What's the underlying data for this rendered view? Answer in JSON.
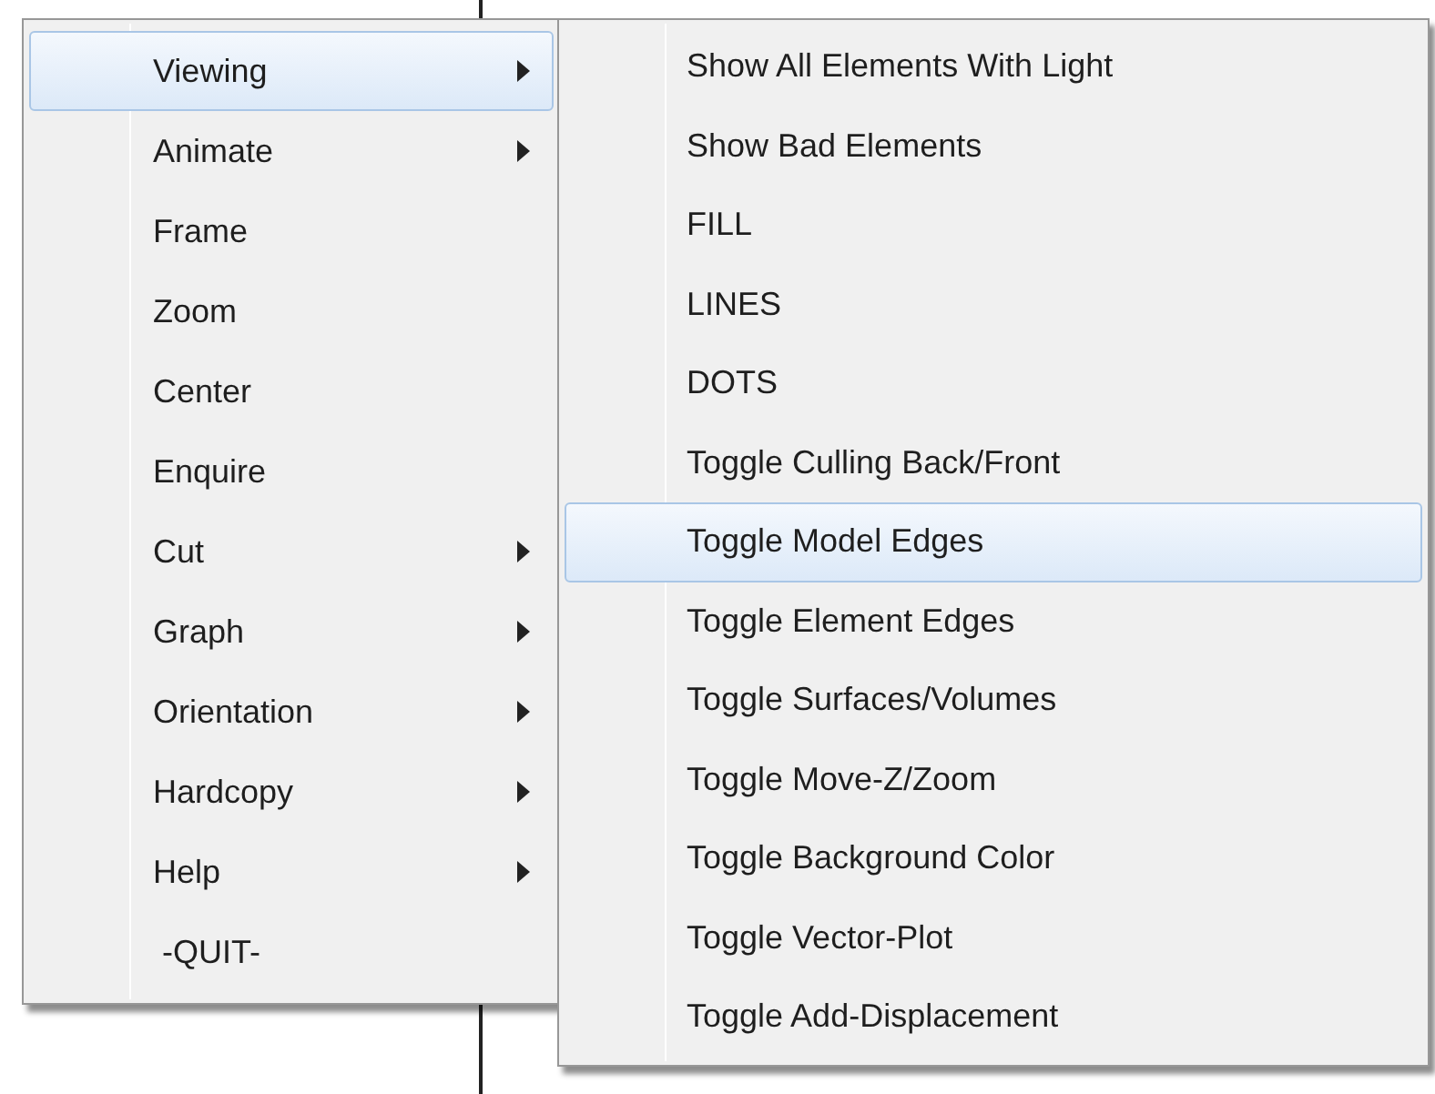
{
  "menu": {
    "items": [
      {
        "label": "Viewing",
        "has_submenu": true,
        "selected": true
      },
      {
        "label": "Animate",
        "has_submenu": true,
        "selected": false
      },
      {
        "label": "Frame",
        "has_submenu": false,
        "selected": false
      },
      {
        "label": "Zoom",
        "has_submenu": false,
        "selected": false
      },
      {
        "label": "Center",
        "has_submenu": false,
        "selected": false
      },
      {
        "label": "Enquire",
        "has_submenu": false,
        "selected": false
      },
      {
        "label": "Cut",
        "has_submenu": true,
        "selected": false
      },
      {
        "label": "Graph",
        "has_submenu": true,
        "selected": false
      },
      {
        "label": "Orientation",
        "has_submenu": true,
        "selected": false
      },
      {
        "label": "Hardcopy",
        "has_submenu": true,
        "selected": false
      },
      {
        "label": "Help",
        "has_submenu": true,
        "selected": false
      },
      {
        "label": " -QUIT-",
        "has_submenu": false,
        "selected": false
      }
    ]
  },
  "submenu": {
    "items": [
      {
        "label": "Show All Elements With Light",
        "selected": false
      },
      {
        "label": "Show Bad Elements",
        "selected": false
      },
      {
        "label": "FILL",
        "selected": false
      },
      {
        "label": "LINES",
        "selected": false
      },
      {
        "label": "DOTS",
        "selected": false
      },
      {
        "label": "Toggle Culling Back/Front",
        "selected": false
      },
      {
        "label": "Toggle Model Edges",
        "selected": true
      },
      {
        "label": "Toggle Element Edges",
        "selected": false
      },
      {
        "label": "Toggle Surfaces/Volumes",
        "selected": false
      },
      {
        "label": "Toggle Move-Z/Zoom",
        "selected": false
      },
      {
        "label": "Toggle Background Color",
        "selected": false
      },
      {
        "label": "Toggle Vector-Plot",
        "selected": false
      },
      {
        "label": "Toggle Add-Displacement",
        "selected": false
      }
    ]
  }
}
